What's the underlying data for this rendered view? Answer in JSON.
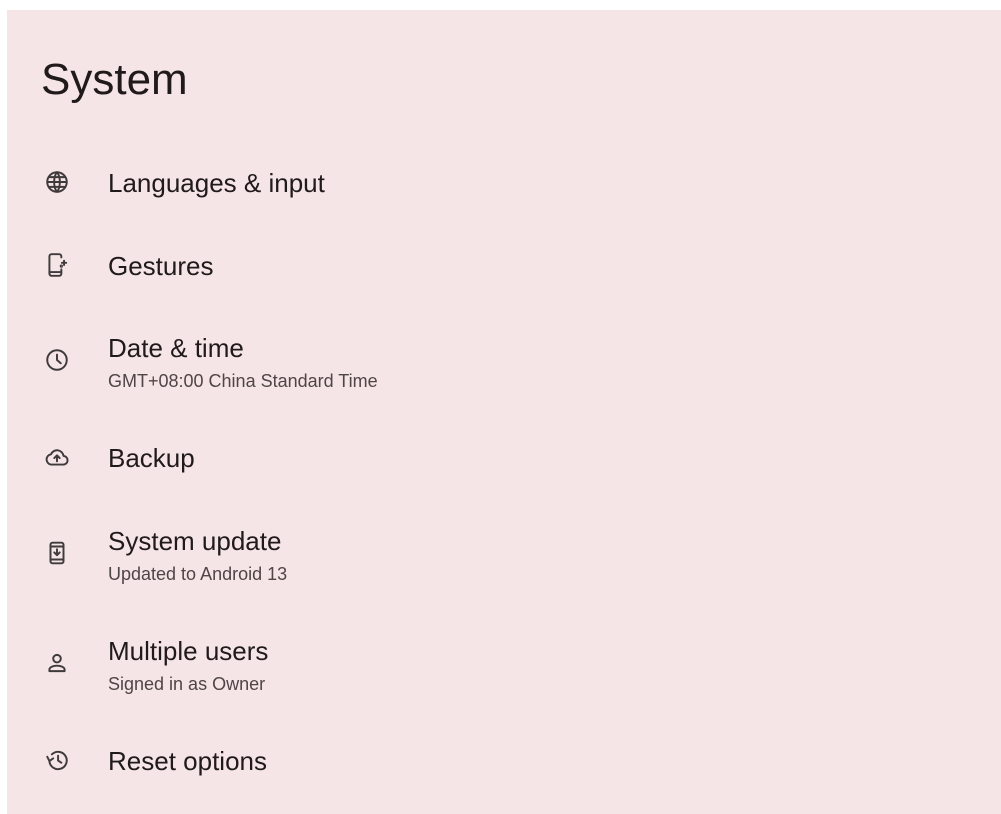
{
  "page": {
    "title": "System",
    "background": "#f6e5e6",
    "text_color": "#201a1b",
    "secondary_text_color": "#4f4546"
  },
  "items": [
    {
      "icon": "globe-icon",
      "label": "Languages & input",
      "summary": ""
    },
    {
      "icon": "gestures-phone-icon",
      "label": "Gestures",
      "summary": ""
    },
    {
      "icon": "clock-icon",
      "label": "Date & time",
      "summary": "GMT+08:00 China Standard Time"
    },
    {
      "icon": "cloud-upload-icon",
      "label": "Backup",
      "summary": ""
    },
    {
      "icon": "system-update-icon",
      "label": "System update",
      "summary": "Updated to Android 13"
    },
    {
      "icon": "person-icon",
      "label": "Multiple users",
      "summary": "Signed in as Owner"
    },
    {
      "icon": "history-icon",
      "label": "Reset options",
      "summary": ""
    }
  ]
}
